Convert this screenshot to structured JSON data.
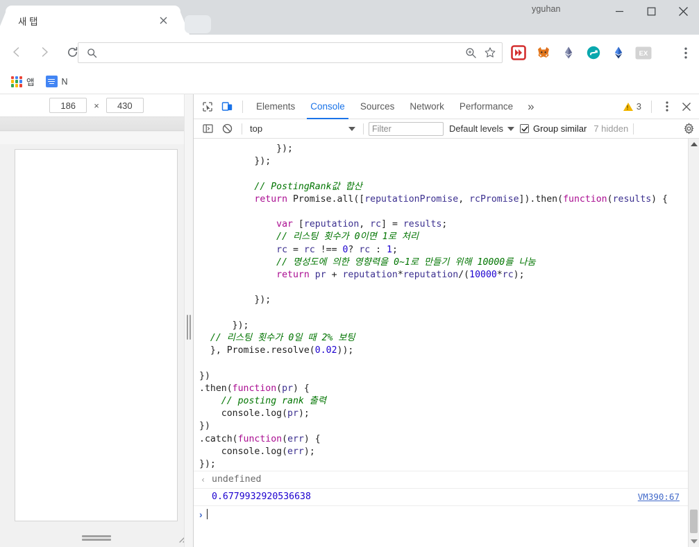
{
  "window": {
    "profile_name": "yguhan",
    "minimize_label": "Minimize",
    "maximize_label": "Maximize",
    "close_label": "Close"
  },
  "tabstrip": {
    "tabs": [
      {
        "title": "새 탭",
        "close_label": "×"
      }
    ],
    "new_tab_label": "+"
  },
  "toolbar": {
    "back_label": "Back",
    "forward_label": "Forward",
    "reload_label": "Reload",
    "omnibox_value": "",
    "omnibox_placeholder": "",
    "zoom_label": "Zoom",
    "bookmark_label": "Bookmark this page",
    "menu_label": "Customize and control Google Chrome",
    "extensions": [
      {
        "name": "fast-forward-extension",
        "letter": "»",
        "color": "#d32f2f"
      },
      {
        "name": "metamask-extension",
        "letter": "🦊",
        "color": "#e2761b"
      },
      {
        "name": "ethereum-gray-extension",
        "letter": "♦",
        "color": "#8a92b2"
      },
      {
        "name": "teal-circle-extension",
        "letter": "◉",
        "color": "#00a0a8"
      },
      {
        "name": "ethereum-blue-extension",
        "letter": "♦",
        "color": "#3c6fd1"
      },
      {
        "name": "ex-extension",
        "letter": "EX",
        "color": "#bdbdbd"
      }
    ]
  },
  "bookmarks": {
    "items": [
      {
        "label": "앱",
        "icon": "apps-grid-icon"
      },
      {
        "label": "N",
        "icon": "docs-icon"
      }
    ]
  },
  "device_pane": {
    "width_value": "186",
    "separator": "×",
    "height_value": "430"
  },
  "devtools": {
    "inspect_label": "Inspect element",
    "device_toggle_label": "Toggle device toolbar",
    "tabs": [
      {
        "label": "Elements",
        "active": false
      },
      {
        "label": "Console",
        "active": true
      },
      {
        "label": "Sources",
        "active": false
      },
      {
        "label": "Network",
        "active": false
      },
      {
        "label": "Performance",
        "active": false
      }
    ],
    "overflow_label": "»",
    "warning_count": "3",
    "more_label": "⋮",
    "close_label": "×",
    "console_toolbar": {
      "sidebar_toggle_label": "Show console sidebar",
      "clear_label": "Clear console",
      "context": "top",
      "filter_placeholder": "Filter",
      "filter_value": "",
      "levels": "Default levels",
      "group_similar": "Group similar",
      "group_similar_checked": true,
      "hidden_count": "7 hidden",
      "settings_label": "Console settings"
    },
    "console": {
      "code_lines": [
        {
          "indent": 14,
          "tokens": [
            {
              "t": "pl",
              "v": "});"
            }
          ]
        },
        {
          "indent": 10,
          "tokens": [
            {
              "t": "pl",
              "v": "});"
            }
          ]
        },
        {
          "indent": 0,
          "tokens": [
            {
              "t": "pl",
              "v": ""
            }
          ]
        },
        {
          "indent": 10,
          "tokens": [
            {
              "t": "cm",
              "v": "// PostingRank값 합산"
            }
          ]
        },
        {
          "indent": 10,
          "tokens": [
            {
              "t": "kw",
              "v": "return"
            },
            {
              "t": "pl",
              "v": " Promise.all(["
            },
            {
              "t": "id",
              "v": "reputationPromise"
            },
            {
              "t": "pl",
              "v": ", "
            },
            {
              "t": "wrap",
              "v": ""
            },
            {
              "t": "id",
              "v": "rcPromise"
            },
            {
              "t": "pl",
              "v": "]).then("
            },
            {
              "t": "kw",
              "v": "function"
            },
            {
              "t": "pl",
              "v": "("
            },
            {
              "t": "id",
              "v": "results"
            },
            {
              "t": "pl",
              "v": ") {"
            }
          ]
        },
        {
          "indent": 0,
          "tokens": [
            {
              "t": "pl",
              "v": ""
            }
          ]
        },
        {
          "indent": 14,
          "tokens": [
            {
              "t": "kw",
              "v": "var"
            },
            {
              "t": "pl",
              "v": " ["
            },
            {
              "t": "id",
              "v": "reputation"
            },
            {
              "t": "pl",
              "v": ", "
            },
            {
              "t": "id",
              "v": "rc"
            },
            {
              "t": "pl",
              "v": "] = "
            },
            {
              "t": "id",
              "v": "results"
            },
            {
              "t": "pl",
              "v": ";"
            }
          ]
        },
        {
          "indent": 14,
          "tokens": [
            {
              "t": "cm",
              "v": "// 리스팅 횟수가 0이면 1로 처리"
            }
          ]
        },
        {
          "indent": 14,
          "tokens": [
            {
              "t": "id",
              "v": "rc"
            },
            {
              "t": "pl",
              "v": " = "
            },
            {
              "t": "id",
              "v": "rc"
            },
            {
              "t": "pl",
              "v": " !== "
            },
            {
              "t": "num",
              "v": "0"
            },
            {
              "t": "pl",
              "v": "? "
            },
            {
              "t": "id",
              "v": "rc"
            },
            {
              "t": "pl",
              "v": " : "
            },
            {
              "t": "num",
              "v": "1"
            },
            {
              "t": "pl",
              "v": ";"
            }
          ]
        },
        {
          "indent": 14,
          "tokens": [
            {
              "t": "cm",
              "v": "// 명성도에 의한 영향력을 0~1로 만들기 위해 10000를 나눔"
            }
          ]
        },
        {
          "indent": 14,
          "tokens": [
            {
              "t": "kw",
              "v": "return"
            },
            {
              "t": "pl",
              "v": " "
            },
            {
              "t": "id",
              "v": "pr"
            },
            {
              "t": "pl",
              "v": " + "
            },
            {
              "t": "id",
              "v": "reputation"
            },
            {
              "t": "pl",
              "v": "*"
            },
            {
              "t": "id",
              "v": "reputation"
            },
            {
              "t": "pl",
              "v": "/("
            },
            {
              "t": "num",
              "v": "10000"
            },
            {
              "t": "pl",
              "v": "*"
            },
            {
              "t": "id",
              "v": "rc"
            },
            {
              "t": "pl",
              "v": ");"
            }
          ]
        },
        {
          "indent": 0,
          "tokens": [
            {
              "t": "pl",
              "v": ""
            }
          ]
        },
        {
          "indent": 10,
          "tokens": [
            {
              "t": "pl",
              "v": "});"
            }
          ]
        },
        {
          "indent": 0,
          "tokens": [
            {
              "t": "pl",
              "v": ""
            }
          ]
        },
        {
          "indent": 6,
          "tokens": [
            {
              "t": "pl",
              "v": "});"
            }
          ]
        },
        {
          "indent": 2,
          "tokens": [
            {
              "t": "cm",
              "v": "// 리스팅 횟수가 0일 때 2% 보팅"
            }
          ]
        },
        {
          "indent": 2,
          "tokens": [
            {
              "t": "pl",
              "v": "}, Promise.resolve("
            },
            {
              "t": "num",
              "v": "0.02"
            },
            {
              "t": "pl",
              "v": "));"
            }
          ]
        },
        {
          "indent": 0,
          "tokens": [
            {
              "t": "pl",
              "v": ""
            }
          ]
        },
        {
          "indent": 0,
          "tokens": [
            {
              "t": "pl",
              "v": "})"
            }
          ]
        },
        {
          "indent": 0,
          "tokens": [
            {
              "t": "pl",
              "v": ".then("
            },
            {
              "t": "kw",
              "v": "function"
            },
            {
              "t": "pl",
              "v": "("
            },
            {
              "t": "id",
              "v": "pr"
            },
            {
              "t": "pl",
              "v": ") {"
            }
          ]
        },
        {
          "indent": 4,
          "tokens": [
            {
              "t": "cm",
              "v": "// posting rank 출력"
            }
          ]
        },
        {
          "indent": 4,
          "tokens": [
            {
              "t": "pl",
              "v": "console.log("
            },
            {
              "t": "id",
              "v": "pr"
            },
            {
              "t": "pl",
              "v": ");"
            }
          ]
        },
        {
          "indent": 0,
          "tokens": [
            {
              "t": "pl",
              "v": "})"
            }
          ]
        },
        {
          "indent": 0,
          "tokens": [
            {
              "t": "pl",
              "v": ".catch("
            },
            {
              "t": "kw",
              "v": "function"
            },
            {
              "t": "pl",
              "v": "("
            },
            {
              "t": "id",
              "v": "err"
            },
            {
              "t": "pl",
              "v": ") {"
            }
          ]
        },
        {
          "indent": 4,
          "tokens": [
            {
              "t": "pl",
              "v": "console.log("
            },
            {
              "t": "id",
              "v": "err"
            },
            {
              "t": "pl",
              "v": ");"
            }
          ]
        },
        {
          "indent": 0,
          "tokens": [
            {
              "t": "pl",
              "v": "});"
            }
          ]
        }
      ],
      "result_line": {
        "arrow": "‹",
        "value": "undefined"
      },
      "log_line": {
        "value": "0.6779932920536638",
        "source": "VM390:67"
      },
      "prompt": {
        "caret": "›",
        "value": ""
      }
    }
  }
}
